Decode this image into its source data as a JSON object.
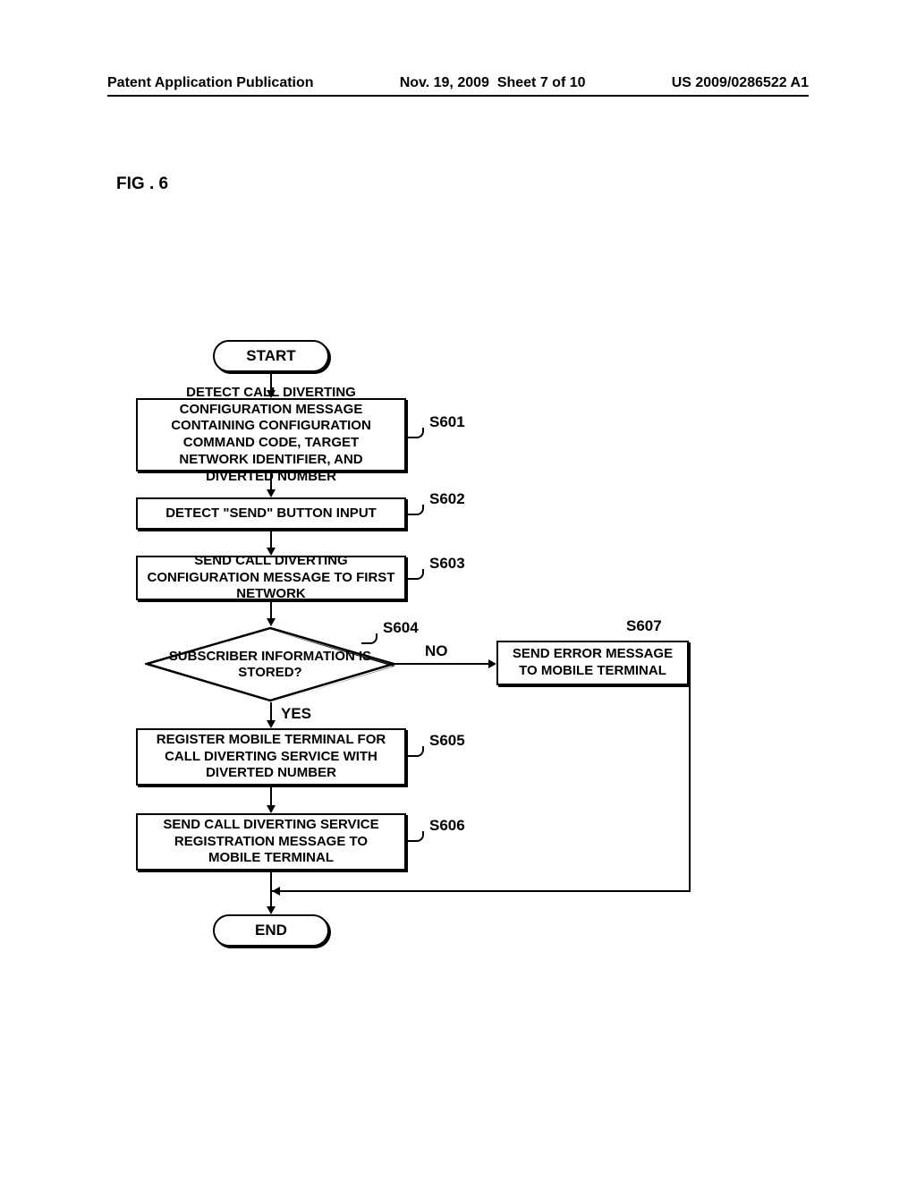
{
  "header": {
    "left": "Patent Application Publication",
    "date": "Nov. 19, 2009",
    "sheet": "Sheet 7 of 10",
    "pubno": "US 2009/0286522 A1"
  },
  "figure_label": "FIG . 6",
  "flow": {
    "start": "START",
    "s601": "DETECT CALL DIVERTING CONFIGURATION MESSAGE CONTAINING CONFIGURATION COMMAND CODE, TARGET NETWORK IDENTIFIER, AND DIVERTED NUMBER",
    "s602": "DETECT  \"SEND\"  BUTTON INPUT",
    "s603": "SEND CALL DIVERTING CONFIGURATION MESSAGE TO FIRST NETWORK",
    "s604": "SUBSCRIBER INFORMATION IS STORED?",
    "s605": "REGISTER MOBILE TERMINAL FOR CALL DIVERTING SERVICE WITH DIVERTED NUMBER",
    "s606": "SEND CALL DIVERTING SERVICE REGISTRATION MESSAGE TO MOBILE TERMINAL",
    "s607": "SEND ERROR MESSAGE TO MOBILE TERMINAL",
    "end": "END"
  },
  "labels": {
    "s601": "S601",
    "s602": "S602",
    "s603": "S603",
    "s604": "S604",
    "s605": "S605",
    "s606": "S606",
    "s607": "S607",
    "yes": "YES",
    "no": "NO"
  }
}
